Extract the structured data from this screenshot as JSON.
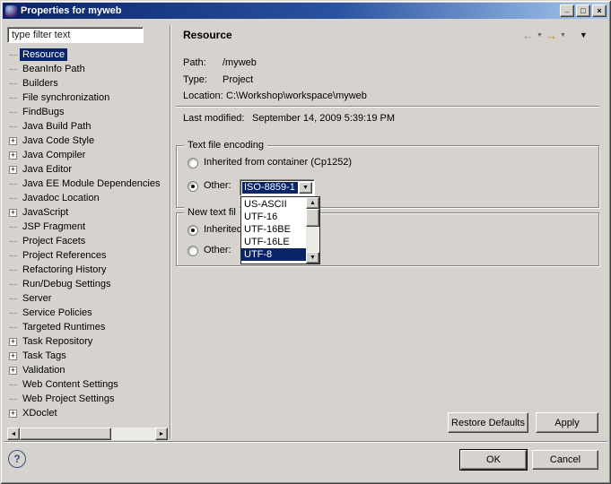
{
  "window": {
    "title": "Properties for myweb"
  },
  "icons": {
    "minimize": "_",
    "maximize": "□",
    "close": "×",
    "back": "←",
    "forward": "→",
    "caret": "▼",
    "menu": "▼",
    "combo_arrow": "▼",
    "scroll_up": "▲",
    "scroll_down": "▼",
    "scroll_left": "◄",
    "scroll_right": "►",
    "expand": "+",
    "help": "?"
  },
  "sidebar": {
    "filter_value": "type filter text",
    "items": [
      {
        "label": "Resource",
        "selected": true,
        "expandable": false
      },
      {
        "label": "BeanInfo Path",
        "selected": false,
        "expandable": false
      },
      {
        "label": "Builders",
        "selected": false,
        "expandable": false
      },
      {
        "label": "File synchronization",
        "selected": false,
        "expandable": false
      },
      {
        "label": "FindBugs",
        "selected": false,
        "expandable": false
      },
      {
        "label": "Java Build Path",
        "selected": false,
        "expandable": false
      },
      {
        "label": "Java Code Style",
        "selected": false,
        "expandable": true
      },
      {
        "label": "Java Compiler",
        "selected": false,
        "expandable": true
      },
      {
        "label": "Java Editor",
        "selected": false,
        "expandable": true
      },
      {
        "label": "Java EE Module Dependencies",
        "selected": false,
        "expandable": false
      },
      {
        "label": "Javadoc Location",
        "selected": false,
        "expandable": false
      },
      {
        "label": "JavaScript",
        "selected": false,
        "expandable": true
      },
      {
        "label": "JSP Fragment",
        "selected": false,
        "expandable": false
      },
      {
        "label": "Project Facets",
        "selected": false,
        "expandable": false
      },
      {
        "label": "Project References",
        "selected": false,
        "expandable": false
      },
      {
        "label": "Refactoring History",
        "selected": false,
        "expandable": false
      },
      {
        "label": "Run/Debug Settings",
        "selected": false,
        "expandable": false
      },
      {
        "label": "Server",
        "selected": false,
        "expandable": false
      },
      {
        "label": "Service Policies",
        "selected": false,
        "expandable": false
      },
      {
        "label": "Targeted Runtimes",
        "selected": false,
        "expandable": false
      },
      {
        "label": "Task Repository",
        "selected": false,
        "expandable": true
      },
      {
        "label": "Task Tags",
        "selected": false,
        "expandable": true
      },
      {
        "label": "Validation",
        "selected": false,
        "expandable": true
      },
      {
        "label": "Web Content Settings",
        "selected": false,
        "expandable": false
      },
      {
        "label": "Web Project Settings",
        "selected": false,
        "expandable": false
      },
      {
        "label": "XDoclet",
        "selected": false,
        "expandable": true
      }
    ]
  },
  "main": {
    "title": "Resource",
    "info": {
      "path_label": "Path:",
      "path_value": "/myweb",
      "type_label": "Type:",
      "type_value": "Project",
      "location_label": "Location:",
      "location_value": "C:\\Workshop\\workspace\\myweb",
      "modified_label": "Last modified:",
      "modified_value": "September 14, 2009 5:39:19 PM"
    },
    "encoding": {
      "group_title": "Text file encoding",
      "inherited_label": "Inherited from container (Cp1252)",
      "other_label": "Other:",
      "combo_value": "ISO-8859-1",
      "options": [
        "US-ASCII",
        "UTF-16",
        "UTF-16BE",
        "UTF-16LE",
        "UTF-8"
      ],
      "selected_option": "UTF-8"
    },
    "delimiter": {
      "group_title": "New text fil",
      "inherited_label": "Inherited",
      "other_label": "Other:"
    },
    "restore_label": "Restore Defaults",
    "apply_label": "Apply"
  },
  "footer": {
    "ok_label": "OK",
    "cancel_label": "Cancel"
  },
  "colors": {
    "face": "#d6d3ce",
    "selection": "#0a246a",
    "titlebar_start": "#0a246a",
    "titlebar_end": "#a6caf0"
  }
}
